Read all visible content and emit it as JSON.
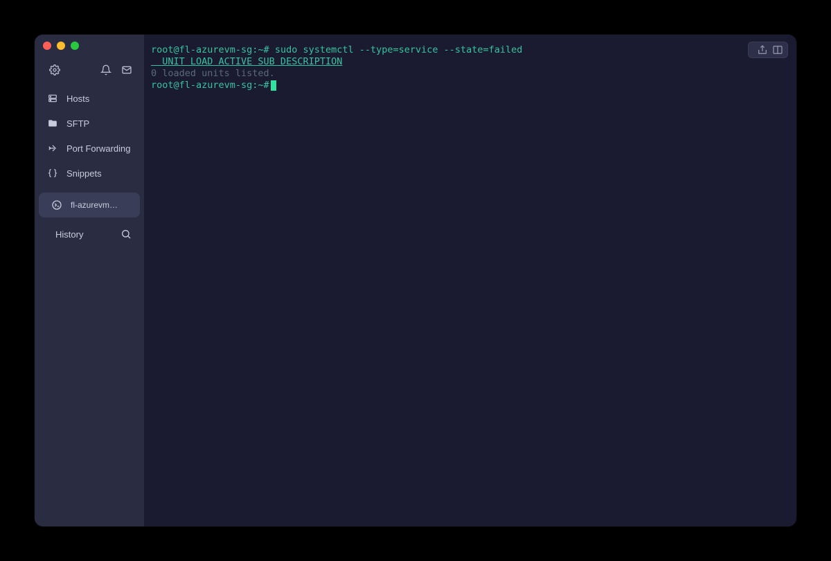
{
  "colors": {
    "sidebar_bg": "#2a2c42",
    "terminal_bg": "#1a1b30",
    "accent": "#37c2a0",
    "cursor": "#2fe3a1"
  },
  "sidebar": {
    "nav": [
      {
        "icon": "hosts",
        "label": "Hosts"
      },
      {
        "icon": "folder",
        "label": "SFTP"
      },
      {
        "icon": "forward",
        "label": "Port Forwarding"
      },
      {
        "icon": "braces",
        "label": "Snippets"
      }
    ],
    "session": {
      "label": "fl-azurevm…"
    },
    "history": {
      "label": "History"
    }
  },
  "topright": {
    "text": ""
  },
  "terminal": {
    "lines": [
      {
        "prompt": "root@fl-azurevm-sg:~#",
        "cmd": " sudo systemctl --type=service --state=failed"
      },
      {
        "header": "  UNIT LOAD ACTIVE SUB DESCRIPTION"
      },
      {
        "muted": "0 loaded units listed."
      },
      {
        "prompt": "root@fl-azurevm-sg:~#",
        "cursor": true
      }
    ]
  }
}
